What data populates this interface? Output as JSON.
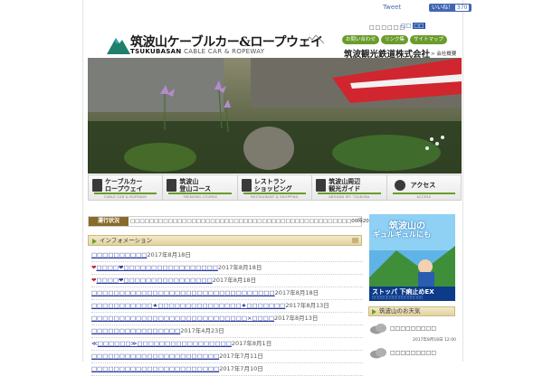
{
  "top": {
    "tweet": "Tweet",
    "fb_like": "いいね！",
    "fb_count": "370",
    "mini": "□□□□□□",
    "lang_a": "□□",
    "lang_b": "□□"
  },
  "logo": {
    "title": "筑波山ケーブルカー&ロープウェイ",
    "sub_bold": "TSUKUBASAN",
    "sub_rest": " CABLE CAR & ROPEWAY"
  },
  "header": {
    "buttons": [
      "お問い合わせ",
      "リンク集",
      "サイトマップ"
    ],
    "company": "筑波観光鉄道株式会社",
    "company_link": "> 会社概要"
  },
  "nav": [
    {
      "label": "ケーブルカー\nロープウェイ",
      "en": "CABLE CAR & ROPEWAY",
      "icon": "cable-car-icon"
    },
    {
      "label": "筑波山\n登山コース",
      "en": "TREKKING COURSE",
      "icon": "hiker-icon"
    },
    {
      "label": "レストラン\nショッピング",
      "en": "RESTAURANT & SHOPPING",
      "icon": "fork-knife-icon"
    },
    {
      "label": "筑波山周辺\n観光ガイド",
      "en": "AROUND MT. TSUKUBA",
      "icon": "map-icon"
    },
    {
      "label": "アクセス",
      "en": "ACCESS",
      "icon": "arrow-icon"
    }
  ],
  "ticker": {
    "label": "運行状況",
    "text": "□□□□□□□□□□□□□□□□□□□□□□□□□□□□□□□□□□□□□□□□□□□□□□□00時20分40分□20時□□□□"
  },
  "info": {
    "title": "インフォメーション",
    "items": [
      {
        "pre": "",
        "title": "□□□□□□□□□□",
        "date": "2017年8月18日"
      },
      {
        "pre": "❤",
        "title": "□□□□❤□□□□□□□□□□□□□□□□□",
        "date": "2017年8月18日"
      },
      {
        "pre": "❤",
        "title": "□□□□❤□□□□□□□□□□□□□□□□",
        "date": "2017年8月18日"
      },
      {
        "pre": "",
        "title": "□□□□□□□□□□□□□□□□□□□□□□□□□□□□□□□□□",
        "date": "2017年8月18日"
      },
      {
        "pre": "",
        "title": "□□□□□□□□□□□★□□□□□□□□□□□□□□□★□□□□□□□",
        "date": "2017年8月13日"
      },
      {
        "pre": "",
        "title": "□□□□□□□□□□□□□□□□□□□□□□□□□□□□×□□□□",
        "date": "2017年8月13日"
      },
      {
        "pre": "",
        "title": "□□□□□□□□□□□□□□□□",
        "date": "2017年4月23日"
      },
      {
        "pre": "≪",
        "title": "□□□□□□≫□□□□□□□□□□□□□□□□□",
        "date": "2017年8月1日"
      },
      {
        "pre": "",
        "title": "□□□□□□□□□□□□□□□□□□□□□□□",
        "date": "2017年7月11日"
      },
      {
        "pre": "",
        "title": "□□□□□□□□□□□□□□□□□□□□□□□",
        "date": "2017年7月10日"
      }
    ]
  },
  "ad": {
    "line1": "筑波山の",
    "line2": "ギュルギュルにも",
    "band": "ストッパ 下痢止めEX",
    "band_sub": "□□□□□□□□□□□□□□□□□"
  },
  "weather": {
    "title": "筑波山のお天気",
    "line1": "□□□□□□□□□",
    "date": "2017年8月18日 12:00",
    "line2": "□□□□□□□□□"
  },
  "colors": {
    "accent_green": "#6a9c2c",
    "info_bar": "#e2d3a0",
    "link": "#2a3a9c"
  }
}
